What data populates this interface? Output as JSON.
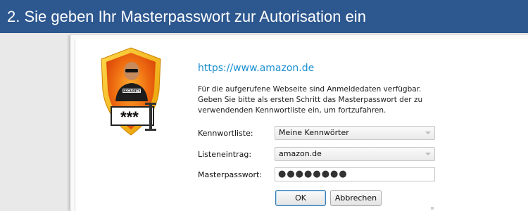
{
  "banner": {
    "title": "2. Sie geben Ihr Masterpasswort zur Autorisation ein"
  },
  "dialog": {
    "site_url": "https://www.amazon.de",
    "message_lines": [
      "Für die aufgerufene Webseite sind Anmeldedaten verfügbar.",
      "Geben Sie bitte als ersten Schritt das Masterpasswort der zu",
      "verwendenden Kennwortliste ein, um fortzufahren."
    ],
    "fields": {
      "password_list": {
        "label": "Kennwortliste:",
        "value": "Meine Kennwörter"
      },
      "list_entry": {
        "label": "Listeneintrag:",
        "value": "amazon.de"
      },
      "master_password": {
        "label": "Masterpasswort:",
        "value": "●●●●●●●●"
      }
    },
    "buttons": {
      "ok": "OK",
      "cancel": "Abbrechen"
    },
    "logo": {
      "badge_text": "SECURITY",
      "stars_text": "***"
    }
  },
  "colors": {
    "banner_bg": "#2d578f",
    "url_color": "#1a8fd0",
    "shield_gold": "#f2a300",
    "shield_orange": "#e8520e"
  }
}
